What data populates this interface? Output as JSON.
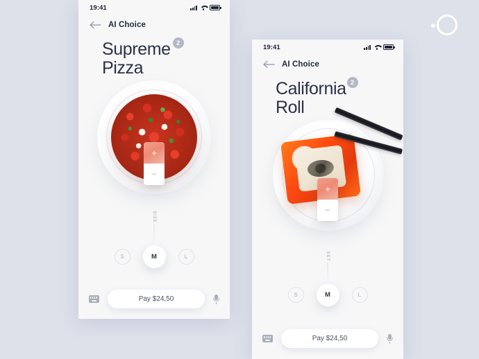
{
  "canvas": {
    "background_color": "#dde1ea",
    "logo_icon": "ring-logo"
  },
  "screens": [
    {
      "id": "supreme-pizza",
      "status_bar": {
        "time": "19:41",
        "icons": [
          "signal-icon",
          "wifi-icon",
          "battery-icon"
        ]
      },
      "nav": {
        "back_icon": "back-arrow-icon",
        "title": "AI Choice"
      },
      "hero": {
        "title_line1": "Supreme",
        "title_line2": "Pizza",
        "badge_count": "2"
      },
      "product": {
        "image_name": "supreme-pizza-photo",
        "plate_name": "white-plate"
      },
      "stepper": {
        "increase_label": "+",
        "decrease_label": "–",
        "accent_color": "#ee8a74"
      },
      "selector": {
        "axis_label": "SIZE",
        "options": [
          {
            "label": "S",
            "selected": false
          },
          {
            "label": "M",
            "selected": true
          },
          {
            "label": "L",
            "selected": false
          }
        ]
      },
      "bottom_bar": {
        "keyboard_icon": "keyboard-icon",
        "pay_label": "Pay $24,50",
        "mic_icon": "microphone-icon"
      }
    },
    {
      "id": "california-roll",
      "status_bar": {
        "time": "19:41",
        "icons": [
          "signal-icon",
          "wifi-icon",
          "battery-icon"
        ]
      },
      "nav": {
        "back_icon": "back-arrow-icon",
        "title": "AI Choice"
      },
      "hero": {
        "title_line1": "California",
        "title_line2": "Roll",
        "badge_count": "2"
      },
      "product": {
        "image_name": "california-roll-photo",
        "plate_name": "white-plate",
        "utensil_name": "chopsticks"
      },
      "stepper": {
        "increase_label": "+",
        "decrease_label": "–",
        "accent_color": "#ee8a74"
      },
      "selector": {
        "axis_label": "SET",
        "options": [
          {
            "label": "S",
            "selected": false
          },
          {
            "label": "M",
            "selected": true
          },
          {
            "label": "L",
            "selected": false
          }
        ]
      },
      "bottom_bar": {
        "keyboard_icon": "keyboard-icon",
        "pay_label": "Pay $24,50",
        "mic_icon": "microphone-icon"
      }
    }
  ]
}
